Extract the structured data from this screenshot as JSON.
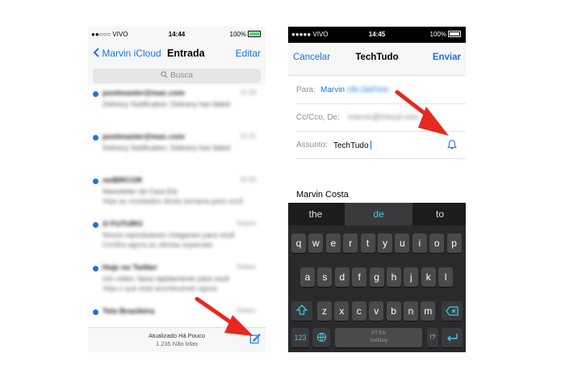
{
  "left_screen": {
    "status": {
      "carrier": "●●○○○ VIVO",
      "time": "14:44",
      "battery": "100%"
    },
    "nav": {
      "back_label": "Marvin iCloud",
      "title": "Entrada",
      "edit_label": "Editar"
    },
    "search": {
      "placeholder": "Busca"
    },
    "emails": [
      {
        "sender": "postmaster@mac.com",
        "time": "11:24",
        "preview1": "Delivery Notification: Delivery has failed",
        "preview2": "",
        "unread": true
      },
      {
        "sender": "postmaster@mac.com",
        "time": "11:21",
        "preview1": "Delivery Notification: Delivery has failed",
        "preview2": "",
        "unread": true
      },
      {
        "sender": "netBRCOR",
        "time": "10:20",
        "preview1": "Newsletter de Cara Ela",
        "preview2": "Veja as novidades desta semana para você",
        "unread": true
      },
      {
        "sender": "O FUTURO",
        "time": "Ontem",
        "preview1": "Novos reprodutores chegaram para você",
        "preview2": "Confira agora as ofertas especiais",
        "unread": true
      },
      {
        "sender": "Hoje no Twitter",
        "time": "Ontem",
        "preview1": "Um vídeo, faixa rapidamente para você",
        "preview2": "Veja o que está acontecendo agora",
        "unread": true
      },
      {
        "sender": "Tela Brasileira",
        "time": "Ontem",
        "preview1": "",
        "preview2": "",
        "unread": true
      }
    ],
    "toolbar": {
      "updated": "Atualizado Há Pouco",
      "unread_count": "1.235 Não lidas"
    }
  },
  "right_screen": {
    "status": {
      "carrier": "●●●●● VIVO",
      "time": "14:45",
      "battery": "100%"
    },
    "nav": {
      "cancel_label": "Cancelar",
      "title": "TechTudo",
      "send_label": "Enviar"
    },
    "to": {
      "label": "Para:",
      "name": "Marvin",
      "email": "Ulo.OeFere"
    },
    "cc": {
      "label": "Cc/Cco, De:",
      "email": "marvin@icloud.com"
    },
    "subject": {
      "label": "Assunto:",
      "value": "TechTudo"
    },
    "signature": "Marvin Costa",
    "keyboard": {
      "suggestions": [
        "the",
        "de",
        "to"
      ],
      "row1": [
        "q",
        "w",
        "e",
        "r",
        "t",
        "y",
        "u",
        "i",
        "o",
        "p"
      ],
      "row2": [
        "a",
        "s",
        "d",
        "f",
        "g",
        "h",
        "j",
        "k",
        "l"
      ],
      "row3": [
        "z",
        "x",
        "c",
        "v",
        "b",
        "n",
        "m"
      ],
      "numbers_label": "123",
      "space_label_1": "PT EN",
      "space_label_2": "Swiftkey",
      "punct_label": "!?"
    }
  },
  "colors": {
    "ios_blue": "#1a73e8",
    "arrow_red": "#e8281e",
    "keyboard_accent": "#3ec7e6"
  }
}
